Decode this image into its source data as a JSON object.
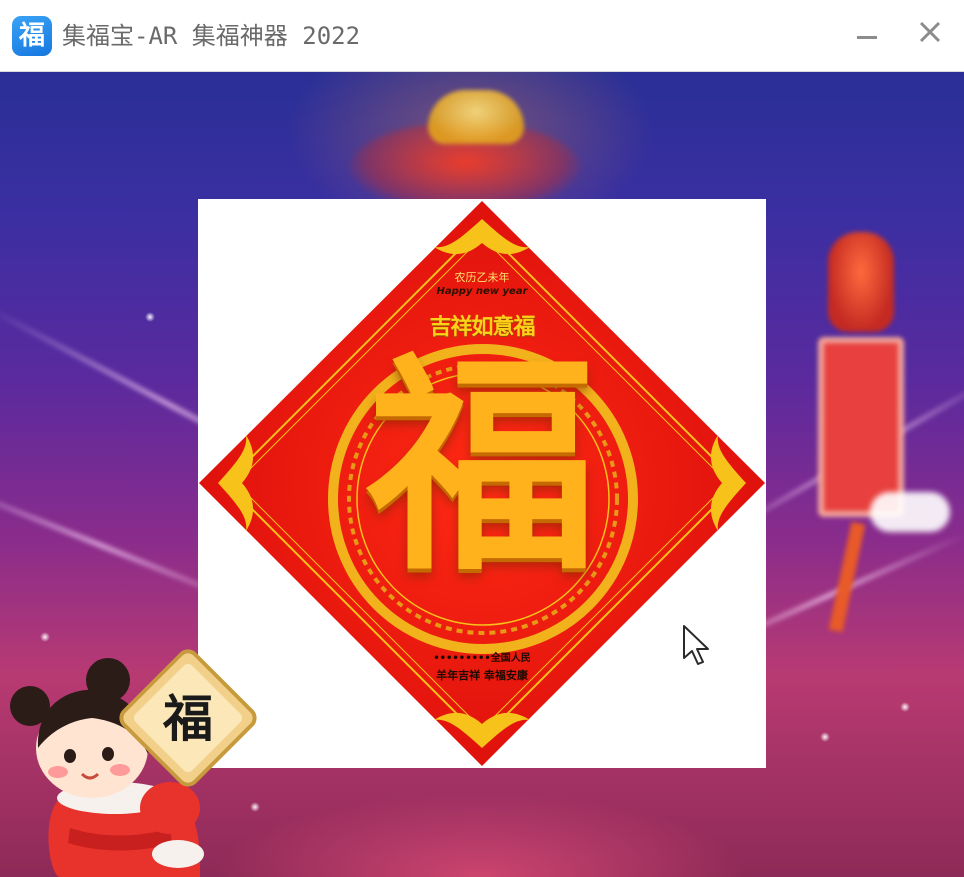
{
  "window": {
    "title": "集福宝-AR 集福神器 2022",
    "logo_glyph": "福",
    "logo_icon": "fu-app-icon",
    "minimize_icon": "minimize-icon",
    "close_icon": "close-icon"
  },
  "card": {
    "lunar_year": "农历乙未年",
    "happy_new_year": "Happy new year",
    "auspicious": "吉祥如意福",
    "main_character": "福",
    "dots_line": "•••••••••全国人民",
    "blessing": "羊年吉祥 幸福安康"
  },
  "mascot": {
    "plaque_character": "福"
  },
  "colors": {
    "scene_top": "#2a2f96",
    "scene_bottom": "#8e2a57",
    "fu_red": "#e8140e",
    "fu_gold": "#ffb21c",
    "logo_blue": "#1677e0"
  }
}
